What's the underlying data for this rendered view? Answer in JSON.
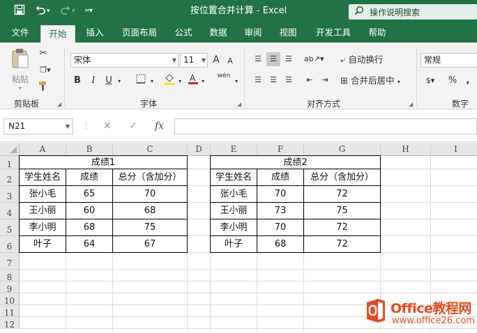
{
  "window": {
    "title": "按位置合并计算  -  Excel"
  },
  "quick_access": {
    "save_icon": "save-icon",
    "undo_icon": "undo-icon",
    "redo_icon": "redo-icon",
    "customize_icon": "customize-icon"
  },
  "search": {
    "placeholder": "操作说明搜索",
    "icon": "lightbulb-search-icon"
  },
  "tabs": [
    "文件",
    "开始",
    "插入",
    "页面布局",
    "公式",
    "数据",
    "审阅",
    "视图",
    "开发工具",
    "帮助"
  ],
  "active_tab": "开始",
  "ribbon": {
    "clipboard": {
      "label": "剪贴板",
      "paste_label": "粘贴"
    },
    "font": {
      "label": "字体",
      "font_name": "宋体",
      "font_size": "11",
      "bold": "B",
      "italic": "I",
      "underline": "U",
      "grow": "A",
      "shrink": "A",
      "phonetic": "wén"
    },
    "alignment": {
      "label": "对齐方式",
      "wrap_text": "自动换行",
      "merge_center": "合并后居中"
    },
    "number": {
      "label": "数字",
      "format": "常规",
      "percent": "%",
      "comma": ","
    }
  },
  "formula_bar": {
    "name_box": "N21",
    "cancel": "✕",
    "enter": "✓",
    "fx": "fx",
    "formula": ""
  },
  "sheet": {
    "columns": [
      "A",
      "B",
      "C",
      "D",
      "E",
      "F",
      "G",
      "H",
      "I"
    ],
    "rows": [
      "1",
      "2",
      "3",
      "4",
      "5",
      "6",
      "7",
      "8",
      "9",
      "10",
      "11",
      "12"
    ],
    "table1": {
      "title": "成绩1",
      "headers": [
        "学生姓名",
        "成绩",
        "总分（含加分）"
      ],
      "rows": [
        [
          "张小毛",
          "65",
          "70"
        ],
        [
          "王小丽",
          "60",
          "68"
        ],
        [
          "李小明",
          "68",
          "75"
        ],
        [
          "叶子",
          "64",
          "67"
        ]
      ]
    },
    "table2": {
      "title": "成绩2",
      "headers": [
        "学生姓名",
        "成绩",
        "总分（含加分）"
      ],
      "rows": [
        [
          "张小毛",
          "70",
          "72"
        ],
        [
          "王小丽",
          "73",
          "75"
        ],
        [
          "李小明",
          "70",
          "72"
        ],
        [
          "叶子",
          "68",
          "72"
        ]
      ]
    }
  },
  "watermark": {
    "brand": "Office教程网",
    "url": "www.office26.com"
  }
}
